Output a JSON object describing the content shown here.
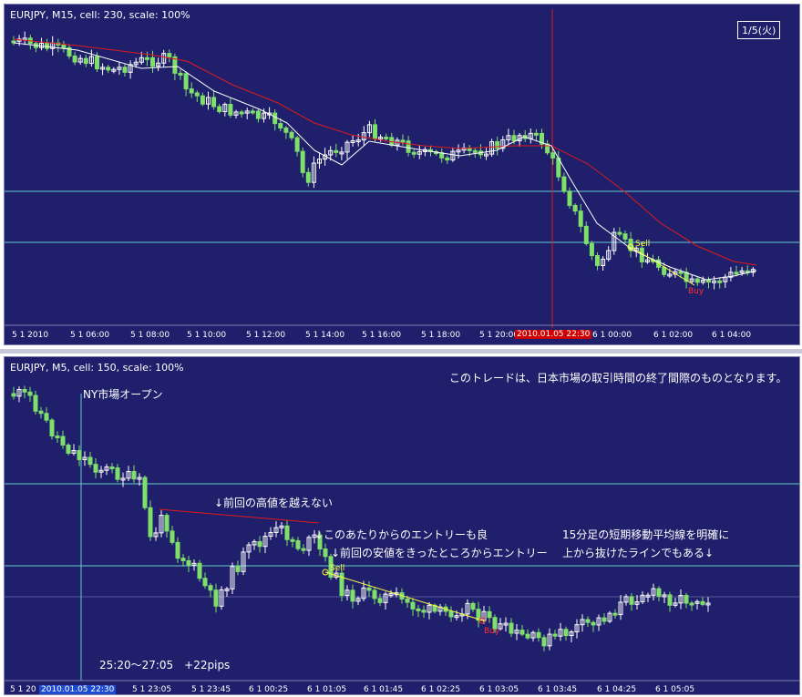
{
  "top_chart": {
    "title": "EURJPY, M15, cell: 230, scale: 100%",
    "date_box": "1/5(火)",
    "x_ticks": [
      "5 1 2010",
      "5 1 06:00",
      "5 1 08:00",
      "5 1 10:00",
      "5 1 12:00",
      "5 1 14:00",
      "5 1 16:00",
      "5 1 18:00",
      "5 1 20:00",
      "6 1 00:00",
      "6 1 02:00",
      "6 1 04:00"
    ],
    "cursor_time": "2010.01.05 22:30",
    "sell_label": "Sell",
    "buy_label": "Buy",
    "colors": {
      "background": "#1f1f6b",
      "bull": "#ffffff",
      "bear": "#7ee06a",
      "ma_fast": "#ffffff",
      "ma_slow": "#e01a1a",
      "hline": "#66cccc",
      "cursor": "#e01a1a"
    }
  },
  "bottom_chart": {
    "title": "EURJPY, M5, cell: 150, scale: 100%",
    "x_ticks": [
      "5 1 20",
      "5 1 23:05",
      "5 1 23:45",
      "6 1 00:25",
      "6 1 01:05",
      "6 1 01:45",
      "6 1 02:25",
      "6 1 03:05",
      "6 1 03:45",
      "6 1 04:25",
      "6 1 05:05"
    ],
    "cursor_time": "2010.01.05 22:30",
    "notes": {
      "top_right": "このトレードは、日本市場の取引時間の終了間際のものとなります。",
      "ny_open": "NY市場オープン",
      "no_break_high": "↓前回の高値を越えない",
      "entry_ok": "↓このあたりからのエントリーも良",
      "entry_break_low": "↓前回の安値をきったところからエントリー",
      "ma_note_1": "15分足の短期移動平均線を明確に",
      "ma_note_2": "上から抜けたラインでもある↓",
      "result": "25:20～27:05　+22pips"
    },
    "sell_label": "Sell",
    "buy_label": "Buy",
    "colors": {
      "background": "#1f1f6b",
      "bull": "#ffffff",
      "bear": "#7ee06a",
      "hline": "#66cccc",
      "resistance": "#e01a1a",
      "trade_line": "#ffff40"
    }
  }
}
